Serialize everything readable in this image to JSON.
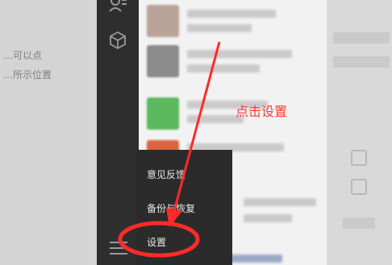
{
  "background": {
    "line1": "可以点",
    "line2": "所示位置"
  },
  "popup_menu": {
    "items": [
      {
        "label": "意见反馈"
      },
      {
        "label": "备份与恢复"
      },
      {
        "label": "设置"
      }
    ]
  },
  "annotation": {
    "label": "点击设置",
    "color": "#ff2a2a"
  },
  "colors": {
    "sidebar": "#2e2e2e",
    "popup": "#2b2b2b",
    "chatlist": "#f2f2f2"
  },
  "icons": [
    "contacts-icon",
    "box-icon",
    "menu-icon"
  ]
}
